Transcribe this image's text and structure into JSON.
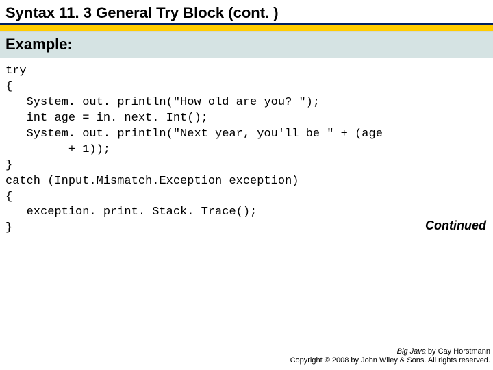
{
  "title": {
    "prefix": "Syntax 11. 3 General Try Block ",
    "cont": "(cont. )"
  },
  "subhead": "Example:",
  "code": {
    "l1": "try",
    "l2": "{",
    "l3": "   System. out. println(\"How old are you? \");",
    "l4": "   int age = in. next. Int();",
    "l5": "   System. out. println(\"Next year, you'll be \" + (age",
    "l6": "         + 1));",
    "l7": "}",
    "l8": "catch (Input.Mismatch.Exception exception)",
    "l9": "{",
    "l10": "   exception. print. Stack. Trace();",
    "l11": "}"
  },
  "continued": "Continued",
  "footer": {
    "line1_book": "Big Java",
    "line1_rest": " by Cay Horstmann",
    "line2": "Copyright © 2008 by John Wiley & Sons. All rights reserved."
  }
}
